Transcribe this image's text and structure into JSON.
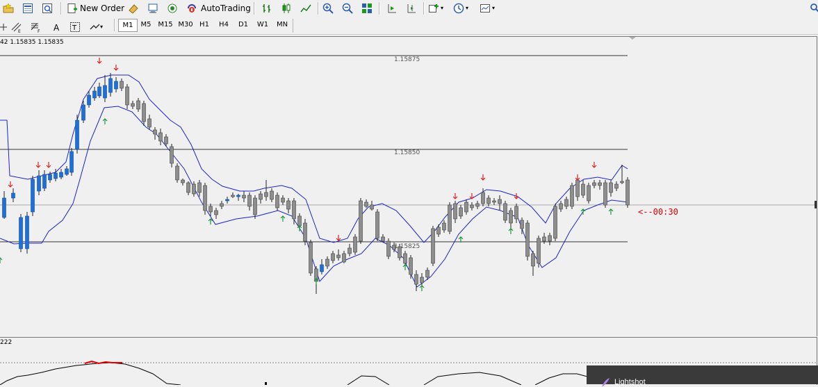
{
  "toolbar": {
    "new_order_label": "New Order",
    "autotrading_label": "AutoTrading",
    "timeframes": [
      "M1",
      "M5",
      "M15",
      "M30",
      "H1",
      "H4",
      "D1",
      "W1",
      "MN"
    ],
    "active_timeframe": "M1"
  },
  "chart": {
    "ohlc_header": "42 1.15835 1.15835",
    "price_levels": [
      "1.15875",
      "1.15850",
      "1.15825"
    ],
    "countdown": "<--00:30"
  },
  "subwindow": {
    "label": "222"
  },
  "notification": {
    "title": "Lightshot"
  }
}
